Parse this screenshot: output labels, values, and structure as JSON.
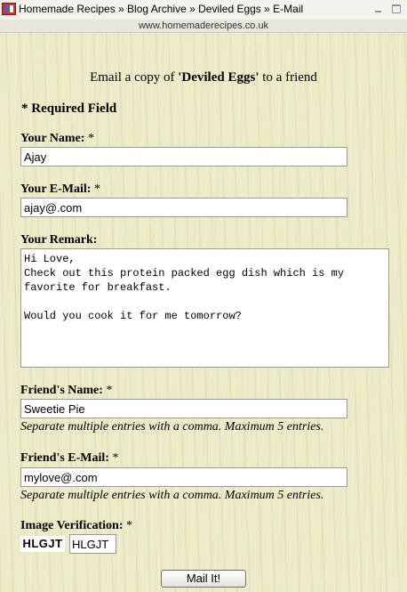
{
  "window": {
    "title": "Homemade Recipes » Blog Archive » Deviled Eggs » E-Mail",
    "url": "www.homemaderecipes.co.uk",
    "icon": "site-favicon"
  },
  "form": {
    "heading_prefix": "Email a copy of ",
    "heading_post": "'Deviled Eggs'",
    "heading_suffix": " to a friend",
    "required_note": "* Required Field",
    "your_name_label": "Your Name:",
    "your_name_value": "Ajay",
    "your_email_label": "Your E-Mail:",
    "your_email_value": "ajay@.com",
    "remark_label": "Your Remark:",
    "remark_value": "Hi Love,\nCheck out this protein packed egg dish which is my favorite for breakfast.\n\nWould you cook it for me tomorrow?",
    "friend_name_label": "Friend's Name:",
    "friend_name_value": "Sweetie Pie",
    "friend_name_hint": "Separate multiple entries with a comma. Maximum 5 entries.",
    "friend_email_label": "Friend's E-Mail:",
    "friend_email_value": "mylove@.com",
    "friend_email_hint": "Separate multiple entries with a comma. Maximum 5 entries.",
    "verification_label": "Image Verification:",
    "captcha_text": "HLGJT",
    "captcha_value": "HLGJT",
    "required_star": "*",
    "submit_label": "Mail It!"
  }
}
